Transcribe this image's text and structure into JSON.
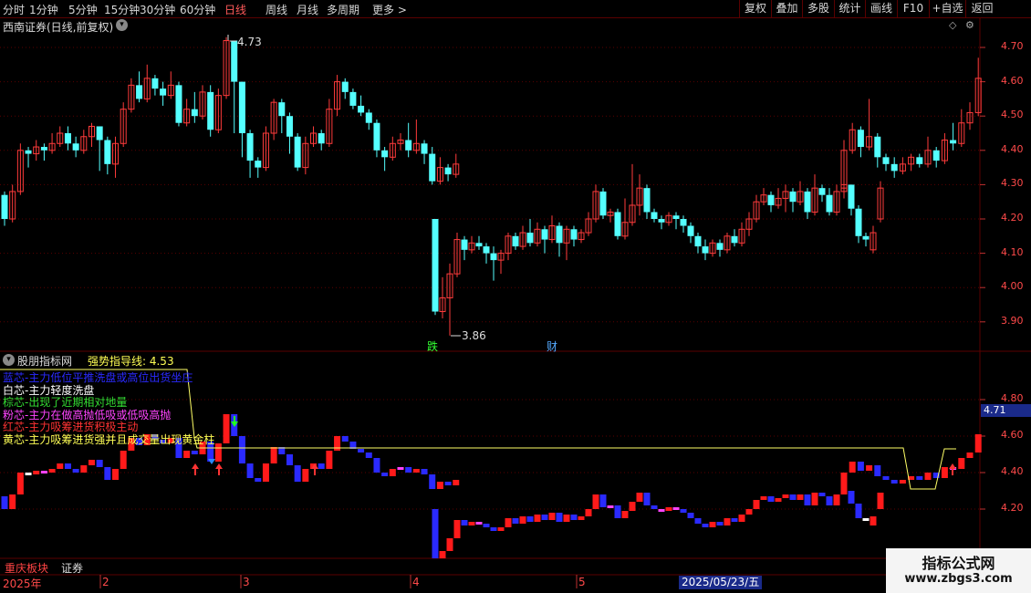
{
  "toolbar": {
    "periods": [
      "分时",
      "1分钟",
      "5分钟",
      "15分钟",
      "30分钟",
      "60分钟",
      "日线",
      "周线",
      "月线",
      "多周期",
      "更多 >"
    ],
    "active_period": "日线",
    "right_buttons": [
      "复权",
      "叠加",
      "多股",
      "统计",
      "画线",
      "F10",
      "+自选",
      "返回"
    ]
  },
  "main_chart": {
    "title": "西南证券(日线,前复权)",
    "high_marker": "4.73",
    "low_marker": "3.86",
    "event_down": "跌",
    "event_finance": "财",
    "yaxis": [
      "4.70",
      "4.60",
      "4.50",
      "4.40",
      "4.30",
      "4.20",
      "4.10",
      "4.00",
      "3.90"
    ]
  },
  "indicator": {
    "name": "股朋指标网",
    "line_name": "强势指导线: 4.53",
    "legend": [
      {
        "text": "蓝芯-主力低位平推洗盘或高位出货坐庄",
        "color": "#2a2aff"
      },
      {
        "text": "白芯-主力轻度洗盘",
        "color": "#ffffff"
      },
      {
        "text": "棕芯-出现了近期相对地量",
        "color": "#33dd33"
      },
      {
        "text": "粉芯-主力在做高抛低吸或低吸高抛",
        "color": "#ff44ff"
      },
      {
        "text": "红芯-主力吸筹进货积极主动",
        "color": "#ff3333"
      },
      {
        "text": "黄芯-主力吸筹进货强并且成交量出现黄金柱",
        "color": "#ffff55"
      }
    ],
    "yaxis": [
      "4.80",
      "4.60",
      "4.40",
      "4.20"
    ],
    "current_value": "4.71"
  },
  "bottom": {
    "tabs": [
      "重庆板块",
      "证券"
    ],
    "months": [
      "2025年",
      "2",
      "3",
      "4",
      "5"
    ],
    "cursor_date": "2025/05/23/五"
  },
  "watermark": {
    "line1": "指标公式网",
    "line2": "www.zbgs3.com"
  },
  "colors": {
    "up": "#ff3b3b",
    "down": "#54ffff",
    "grid": "#5a0000",
    "guide": "#ffff66"
  },
  "chart_data": {
    "type": "candlestick",
    "title": "西南证券(日线,前复权)",
    "ylim": [
      3.85,
      4.78
    ],
    "candles": [
      [
        4.27,
        4.2,
        4.28,
        4.18
      ],
      [
        4.2,
        4.28,
        4.3,
        4.19
      ],
      [
        4.28,
        4.4,
        4.42,
        4.27
      ],
      [
        4.4,
        4.39,
        4.41,
        4.35
      ],
      [
        4.39,
        4.41,
        4.43,
        4.37
      ],
      [
        4.41,
        4.4,
        4.42,
        4.37
      ],
      [
        4.4,
        4.42,
        4.45,
        4.39
      ],
      [
        4.42,
        4.45,
        4.47,
        4.41
      ],
      [
        4.45,
        4.42,
        4.47,
        4.4
      ],
      [
        4.42,
        4.4,
        4.44,
        4.38
      ],
      [
        4.4,
        4.44,
        4.46,
        4.39
      ],
      [
        4.44,
        4.47,
        4.48,
        4.41
      ],
      [
        4.47,
        4.43,
        4.47,
        4.34
      ],
      [
        4.43,
        4.36,
        4.44,
        4.33
      ],
      [
        4.36,
        4.42,
        4.44,
        4.32
      ],
      [
        4.42,
        4.52,
        4.54,
        4.41
      ],
      [
        4.52,
        4.59,
        4.61,
        4.51
      ],
      [
        4.59,
        4.55,
        4.63,
        4.54
      ],
      [
        4.55,
        4.61,
        4.65,
        4.54
      ],
      [
        4.61,
        4.58,
        4.62,
        4.56
      ],
      [
        4.58,
        4.56,
        4.6,
        4.53
      ],
      [
        4.56,
        4.59,
        4.63,
        4.55
      ],
      [
        4.59,
        4.48,
        4.6,
        4.47
      ],
      [
        4.48,
        4.52,
        4.55,
        4.47
      ],
      [
        4.52,
        4.5,
        4.57,
        4.48
      ],
      [
        4.5,
        4.57,
        4.59,
        4.49
      ],
      [
        4.57,
        4.46,
        4.59,
        4.44
      ],
      [
        4.46,
        4.56,
        4.58,
        4.45
      ],
      [
        4.56,
        4.72,
        4.73,
        4.55
      ],
      [
        4.72,
        4.6,
        4.72,
        4.45
      ],
      [
        4.6,
        4.45,
        4.6,
        4.38
      ],
      [
        4.45,
        4.37,
        4.46,
        4.32
      ],
      [
        4.37,
        4.35,
        4.38,
        4.32
      ],
      [
        4.35,
        4.45,
        4.47,
        4.34
      ],
      [
        4.45,
        4.54,
        4.55,
        4.43
      ],
      [
        4.54,
        4.5,
        4.55,
        4.45
      ],
      [
        4.5,
        4.44,
        4.51,
        4.39
      ],
      [
        4.44,
        4.35,
        4.45,
        4.34
      ],
      [
        4.35,
        4.42,
        4.44,
        4.33
      ],
      [
        4.42,
        4.45,
        4.47,
        4.41
      ],
      [
        4.45,
        4.42,
        4.46,
        4.4
      ],
      [
        4.42,
        4.52,
        4.55,
        4.41
      ],
      [
        4.52,
        4.6,
        4.62,
        4.5
      ],
      [
        4.6,
        4.57,
        4.61,
        4.55
      ],
      [
        4.57,
        4.53,
        4.58,
        4.52
      ],
      [
        4.53,
        4.51,
        4.56,
        4.5
      ],
      [
        4.51,
        4.48,
        4.52,
        4.46
      ],
      [
        4.48,
        4.4,
        4.49,
        4.38
      ],
      [
        4.4,
        4.38,
        4.41,
        4.34
      ],
      [
        4.38,
        4.42,
        4.44,
        4.37
      ],
      [
        4.42,
        4.43,
        4.45,
        4.4
      ],
      [
        4.43,
        4.4,
        4.48,
        4.38
      ],
      [
        4.4,
        4.42,
        4.49,
        4.39
      ],
      [
        4.42,
        4.39,
        4.43,
        4.36
      ],
      [
        4.39,
        4.31,
        4.41,
        4.3
      ],
      [
        4.31,
        4.35,
        4.38,
        4.3
      ],
      [
        4.35,
        4.33,
        4.36,
        4.31
      ],
      [
        4.33,
        4.36,
        4.39,
        4.32
      ],
      [
        4.2,
        3.93,
        4.2,
        3.92
      ],
      [
        3.93,
        3.97,
        4.03,
        3.91
      ],
      [
        3.97,
        4.04,
        4.07,
        3.86
      ],
      [
        4.04,
        4.14,
        4.16,
        4.03
      ],
      [
        4.14,
        4.11,
        4.15,
        4.08
      ],
      [
        4.11,
        4.13,
        4.15,
        4.1
      ],
      [
        4.13,
        4.12,
        4.15,
        4.11
      ],
      [
        4.12,
        4.1,
        4.13,
        4.07
      ],
      [
        4.1,
        4.08,
        4.12,
        4.02
      ],
      [
        4.08,
        4.1,
        4.11,
        4.04
      ],
      [
        4.1,
        4.15,
        4.16,
        4.08
      ],
      [
        4.15,
        4.12,
        4.16,
        4.11
      ],
      [
        4.12,
        4.16,
        4.18,
        4.11
      ],
      [
        4.16,
        4.13,
        4.2,
        4.12
      ],
      [
        4.13,
        4.17,
        4.19,
        4.12
      ],
      [
        4.17,
        4.14,
        4.18,
        4.1
      ],
      [
        4.14,
        4.18,
        4.21,
        4.13
      ],
      [
        4.18,
        4.13,
        4.19,
        4.09
      ],
      [
        4.13,
        4.17,
        4.18,
        4.08
      ],
      [
        4.17,
        4.14,
        4.18,
        4.12
      ],
      [
        4.14,
        4.16,
        4.17,
        4.13
      ],
      [
        4.16,
        4.2,
        4.22,
        4.15
      ],
      [
        4.2,
        4.28,
        4.3,
        4.19
      ],
      [
        4.28,
        4.21,
        4.29,
        4.2
      ],
      [
        4.21,
        4.22,
        4.23,
        4.19
      ],
      [
        4.22,
        4.15,
        4.23,
        4.14
      ],
      [
        4.15,
        4.19,
        4.26,
        4.14
      ],
      [
        4.19,
        4.24,
        4.36,
        4.18
      ],
      [
        4.24,
        4.29,
        4.33,
        4.21
      ],
      [
        4.29,
        4.22,
        4.3,
        4.2
      ],
      [
        4.22,
        4.2,
        4.23,
        4.19
      ],
      [
        4.2,
        4.19,
        4.21,
        4.17
      ],
      [
        4.19,
        4.21,
        4.22,
        4.18
      ],
      [
        4.21,
        4.2,
        4.22,
        4.17
      ],
      [
        4.2,
        4.18,
        4.21,
        4.16
      ],
      [
        4.18,
        4.15,
        4.19,
        4.13
      ],
      [
        4.15,
        4.12,
        4.16,
        4.1
      ],
      [
        4.12,
        4.1,
        4.14,
        4.08
      ],
      [
        4.1,
        4.13,
        4.14,
        4.09
      ],
      [
        4.13,
        4.11,
        4.14,
        4.09
      ],
      [
        4.11,
        4.15,
        4.16,
        4.1
      ],
      [
        4.15,
        4.13,
        4.17,
        4.12
      ],
      [
        4.13,
        4.17,
        4.19,
        4.12
      ],
      [
        4.17,
        4.2,
        4.22,
        4.15
      ],
      [
        4.2,
        4.25,
        4.27,
        4.19
      ],
      [
        4.25,
        4.27,
        4.29,
        4.24
      ],
      [
        4.27,
        4.24,
        4.28,
        4.22
      ],
      [
        4.24,
        4.26,
        4.29,
        4.23
      ],
      [
        4.26,
        4.28,
        4.3,
        4.22
      ],
      [
        4.28,
        4.25,
        4.29,
        4.22
      ],
      [
        4.25,
        4.28,
        4.31,
        4.24
      ],
      [
        4.28,
        4.22,
        4.29,
        4.2
      ],
      [
        4.22,
        4.29,
        4.33,
        4.21
      ],
      [
        4.29,
        4.27,
        4.3,
        4.25
      ],
      [
        4.27,
        4.22,
        4.29,
        4.21
      ],
      [
        4.22,
        4.28,
        4.3,
        4.21
      ],
      [
        4.28,
        4.3,
        4.31,
        4.26
      ],
      [
        4.3,
        4.23,
        4.3,
        4.21
      ],
      [
        4.23,
        4.15,
        4.24,
        4.13
      ],
      [
        4.15,
        4.14,
        4.16,
        4.12
      ],
      [
        4.11,
        4.16,
        4.18,
        4.1
      ],
      [
        4.2,
        4.29,
        4.31,
        4.19
      ],
      [
        4.29,
        4.4,
        4.43,
        4.28
      ],
      [
        4.4,
        4.46,
        4.48,
        4.39
      ],
      [
        4.46,
        4.41,
        4.47,
        4.38
      ],
      [
        4.41,
        4.44,
        4.55,
        4.4
      ],
      [
        4.44,
        4.38,
        4.45,
        4.35
      ],
      [
        4.38,
        4.36,
        4.39,
        4.34
      ],
      [
        4.36,
        4.34,
        4.38,
        4.32
      ],
      [
        4.34,
        4.36,
        4.38,
        4.33
      ],
      [
        4.36,
        4.38,
        4.39,
        4.34
      ],
      [
        4.38,
        4.36,
        4.39,
        4.35
      ],
      [
        4.36,
        4.4,
        4.44,
        4.35
      ],
      [
        4.4,
        4.37,
        4.41,
        4.35
      ],
      [
        4.37,
        4.43,
        4.45,
        4.36
      ],
      [
        4.43,
        4.42,
        4.48,
        4.4
      ],
      [
        4.42,
        4.48,
        4.52,
        4.41
      ],
      [
        4.48,
        4.51,
        4.54,
        4.46
      ],
      [
        4.51,
        4.61,
        4.67,
        4.5
      ]
    ]
  }
}
